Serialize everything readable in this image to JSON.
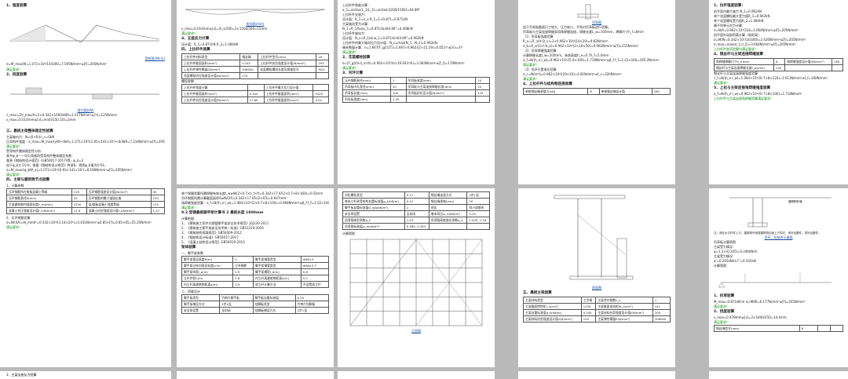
{
  "p1": {
    "s1": "1、强度验算",
    "cap1": "弯矩图(kN·m)",
    "f1": "σ=M_max/W=1.071×10⁶/141000=7.595N/mm²≤[f]=205N/mm²",
    "ok": "满足要求！",
    "s2": "2、挠度验算",
    "cap2": "剪力图(kN)",
    "f2": "τ_max=2V_max/A=2×0.542×1000/489=2.217N/mm²≤[τ]=125N/mm²",
    "f3": "ν_max=0.014mm≤[ν]=min[l/150,10]=2mm",
    "s3": "三、悬挑主梁整体稳定性验算",
    "f4": "主梁轴向力：N=(0+0)/n_s=0kN",
    "f5": "压弯构件强度：σ_max=M_max/(γW)+N/A=1.071×10⁶/(1.05×141×10³)+0/489=7.234N/mm²≤[f]=205N/mm²",
    "ok2": "满足要求！",
    "f6": "受弯构件整体稳定性分析：",
    "f7": "其中φ_b——均匀弯曲的受弯构件整体稳定系数：",
    "f8": "查表《钢结构设计规范》(GB50017-2017)得，φ_b=2",
    "f9": "由于φ_b大于0.6，根据《钢结构设计规范》附录B，得到φ_b值为0.93。",
    "f10": "σ=M_max/(φ_bW_x)=1.071×10⁶/(0.93×141×10³)=8.168N/mm²≤[f]=205N/mm²",
    "ok3": "满足要求！",
    "s4": "四、主梁与建筑物节点验算",
    "s4a": "1、计算参数",
    "t1": [
      [
        "压环钢筋所在楼板混凝土等级",
        "C25",
        "压环钢筋强度设计值(N/mm²)",
        "50"
      ],
      [
        "压环钢筋直径d(mm)",
        "20",
        "压环钢筋的最小锚固长度",
        "150"
      ],
      [
        "主梁建筑物内锚固长度L_m(mm)",
        "1200",
        "梁/楼板混凝土强度等级",
        "C25"
      ],
      [
        "混凝土抗压强度设计值f_c(N/mm²)",
        "11.9",
        "混凝土抗拉强度设计值f_t(N/mm²)",
        "1.27"
      ]
    ],
    "f11": "2、压环钢筋验算",
    "f12": "σ=N/(4A)=N_m/πd²=0.542×10³/(3.14×20²)=0.431N/mm²≤0.85×[f]=0.85×65=55.25N/mm²",
    "ok4": "满足要求！",
    "s5": "3、主梁支座反力验算"
  },
  "p2": {
    "cap1": "变形图(mm)",
    "f1": "ν_max=0.014mm≤[ν]=2l_x/200=2×1500/200=15mm",
    "ok": "满足要求！",
    "s1": "4、支座反力计算",
    "f2": "设计值：R_1=0.871kN  R_2=1.084kN",
    "s2": "四、上拉杆件验算",
    "t1": [
      [
        "上拉杆件材料类型",
        "钢丝绳",
        "上拉杆件型号(mm)",
        "20"
      ],
      [
        "上拉杆件截面面积(mm²)",
        "0.342",
        "上拉杆件抗拉强度设计值(N/mm²)",
        "205"
      ],
      [
        "上拉杆件弹性模量(N/mm²)",
        "206000",
        "花篮螺栓螺纹长度及规格型号",
        "M22"
      ],
      [
        "花篮螺栓抗拉强度设计值(N/mm²)",
        "170",
        "",
        ""
      ]
    ],
    "note": "螺栓参数：",
    "t2": [
      [
        "上拉杆件角度计算",
        "",
        "上拉杆件最大拉力设计值",
        ""
      ],
      [
        "上拉杆件截面面积(mm²)",
        "0.342",
        "上拉杆件截面面积(mm²)",
        "5420"
      ],
      [
        "上拉杆件抗拉强度设计值(N/mm²)",
        "17.65",
        "上拉杆件截面面积(mm²)",
        "4.52"
      ]
    ],
    "f3": "单个焊缝验算所需焊缝有效长度l_w≥N/(2×0.7×h_f×f)=0.342×17.6/(2×0.7×8×160)=0.03mm",
    "f4": "吊环钢筋所需计算截面面积A≥N/(2f)=0.342×17.65/(2×65)=0.047mm²",
    "f5": "角焊缝强度验算：σ_f=N/(h_e·l_w)=1.084×10³/(2×0.7×8×100)=0.968N/mm²≤β_f·f_f=1.22×160=195.2N/mm²",
    "ok2": "满足要求！",
    "s3": "9.2 型钢悬挑脚手架计算书 2 悬挑长度 1800mm",
    "s4": "计算依据：",
    "refs": [
      "1、《建筑施工扣件式钢管脚手架安全技术规范》JGJ130-2011",
      "2、《建筑施工脚手架安全技术统一标准》GB51210-2016",
      "3、《建筑结构荷载规范》GB50009-2012",
      "4、《钢结构设计标准》GB50017-2017",
      "5、《混凝土结构设计规范》GB50010-2010"
    ],
    "s5": "架体验算",
    "s6": "一、脚手架参数",
    "t3": [
      [
        "脚手架搭设高度H(m)",
        "1",
        "脚手架钢管类型",
        "Φ48×3"
      ],
      [
        "脚手架沿纵向搭设长度L(m)",
        "立杆横距",
        "脚手架钢管类型",
        "Φ48×2.7"
      ],
      [
        "脚手架纵距l_a(m)",
        "1.5",
        "脚手架横距l_b(m)",
        "0.8"
      ],
      [
        "立杆步距h(m)",
        "1.8",
        "内立杆离建筑物距离a(m)",
        "0.2"
      ],
      [
        "内立杆离建筑物距离a(m)",
        "0.9",
        "双立杆计算方法",
        "不设置双立杆"
      ]
    ],
    "s7": "二、荷载设计",
    "t4": [
      [
        "脚手板类型",
        "竹串片脚手板",
        "脚手板自重标准值",
        "0.35"
      ],
      [
        "脚手板铺设方式",
        "2步1设",
        "挡脚板类型",
        "竹串片挡脚板"
      ],
      [
        "安全网设置",
        "全封闭",
        "挡脚板铺设方式",
        "2步1设"
      ]
    ]
  },
  "p3": {
    "f1": "上拉杆件角度计算：",
    "f2": "α_1=arctan(L_1/L_2)=arctan(3200/1500)=64.89°",
    "f3": "上拉杆件支座力：",
    "f4": "设计值：R_1=n_x·R_1=1×0.871=0.871kN",
    "f5": "主梁轴向受力计算：",
    "f6": "N_1=R_1/tanα_1=0.871/tan64.89°=0.408kN",
    "f7": "上拉杆件轴向力：",
    "f8": "设计值：N_z=R_1/sinα_1=0.871/sin64.89°=0.962kN",
    "f9": "上拉杆件的最大轴向拉力设计值：N_s=max[N_1...N_z]=0.962kN",
    "f10": "绳夹数量计算：n=1.667[F_g]/(2T)=1.667×0.962/(2×15.19)=0.053个≤[n]=3个",
    "ok": "满足要求！",
    "s1": "2、花篮螺栓验算",
    "f11": "σ=[F_g]/(π·d_e²/4)=0.962×10³/(π×19.933²/4)=3.083N/mm²≤[f_t]=170N/mm²",
    "ok2": "满足要求！",
    "s2": "3、吊环计算",
    "t1": [
      [
        "压环钢筋直径(mm)",
        "1",
        "吊耳板厚度(mm)",
        "10"
      ],
      [
        "吊耳板内孔直径(mm)",
        "20",
        "吊耳板与主梁连接焊缝长度(mm)",
        "10"
      ],
      [
        "吊耳板长度(mm)",
        "100",
        "吊耳板抗拉设计值(N/mm²)",
        "215"
      ],
      [
        "吊耳板宽度(mm)",
        "1.25",
        "",
        ""
      ]
    ],
    "t2": [
      [
        "对拉螺栓类型",
        "0.17",
        "钢丝绳连接方式",
        "2步1设"
      ],
      [
        "每米立杆承受结构自重标准值g_k(kN/m)",
        "0.12",
        "钢丝绳规格(mm)",
        "20"
      ],
      [
        "脚手板自重标准值G_kjb(kN/m²)",
        "2",
        "地区",
        "四川成都市"
      ],
      [
        "安全网设置",
        "全封闭",
        "基本风压ω_0(kN/m²)",
        "0.25"
      ],
      [
        "风荷载体型系数μ_s",
        "1.04",
        "风荷载高度变化系数μ_z",
        "1.433, 1.34"
      ],
      [
        "风荷载标准值ω_k(kN/m²)",
        "0.369, 0.344",
        "",
        ""
      ]
    ],
    "cap": "计算简图",
    "cap2": "立面图"
  },
  "p4": {
    "cap1": "吊耳图",
    "f1": "由于吊耳板截面尺寸较大，压力较小，不再对吊耳板进行验算。",
    "f2": "吊耳板与主梁连接焊缝采用角焊缝连接，焊缝长度L_w=100mm，焊脚尺寸h_f=8mm",
    "s1": "（1）吊耳板强度验算",
    "f3": "R_z=2F_z/(t·D_c)=2×0.962×10³/(10×20)=9.62N/mm²",
    "f4": "σ_b=R_z/(2×t·b_e)=0.962×10³/(2×10×50)=0.962N/mm²≤[f]=215N/mm²",
    "s2": "（2）吊耳焊缝强度验算",
    "f5": "计算焊缝长度l_w=100mm，有效高度h_e=0.7h_f=5.6mm",
    "f6": "σ_f=N/(h_e·l_w)=0.962×10³/(5.6×100)=1.718N/mm²≤β_f·f_f=1.22×160=195.2N/mm²",
    "ok": "满足要求！",
    "s3": "（3）吊环孔壁承压验算",
    "f7": "σ_c=N/(d·t)=0.962×10³/(20×10)=4.81N/mm²≤f_c=320N/mm²",
    "ok2": "满足要求！",
    "s4": "4、上拉杆件与结构物连接验算",
    "t1": [
      [
        "单根钢丝绳承载力(kN)",
        "8",
        "单根钢丝绳设计值",
        "160"
      ]
    ],
    "cap2": "剖面图",
    "s5": "五、悬挑主梁验算",
    "t2": [
      [
        "主梁材料类型",
        "工字钢",
        "主梁合并根数n_s",
        "1"
      ],
      [
        "主梁截面惯性矩I_x(cm⁴)",
        "1130",
        "主梁截面抵抗矩W_x(cm³)",
        "141"
      ],
      [
        "主梁自重标准值g_k(kN/m)",
        "0.205",
        "主梁材料抗弯强度设计值f(N/mm²)",
        "205"
      ],
      [
        "主梁材料抗剪强度设计值τ(N/mm²)",
        "125",
        "主梁弹性模量E(N/mm²)",
        "206000"
      ]
    ]
  },
  "p5": {
    "s1": "1、拉杆强度验算：",
    "f1": "由平面内最大轴力 N_1=0.962kN",
    "f2": "单个花篮螺栓最大受力值R_1=0.962kN",
    "f3": "单个花篮螺栓受力值R_2=1.084kN",
    "f4": "最不利单元内力计算：",
    "f5": "σ=N/A=0.962×10³/314=3.064N/mm²≤[f]=205N/mm²",
    "f6": "由平面外局部荷载计算（取距离）",
    "f7": "σ=M/W=0.342×10⁶/141000=2.426N/mm²≤[f]=205N/mm²",
    "f8": "σ_max=max(σ_1,σ_2)=3.064N/mm²≤[f]=205N/mm²",
    "ok": "上拉杆件各项验算均满足要求！",
    "s2": "4、钢丝杆与主梁连接焊缝验算",
    "t1": [
      [
        "角焊缝焊脚尺寸h_f(mm)",
        "8",
        "角焊缝强度设计值f(N/mm²)",
        "160"
      ],
      [
        "钢丝杆与主梁连接焊缝长度l_w(mm)",
        "120",
        "",
        ""
      ]
    ],
    "f9": "钢丝杆与主梁连接焊缝强度验算：",
    "f10": "τ_f=N/(h_e·l_w)=1.084×10³/(0.7×8×120)=1.613N/mm²≤f_f=160N/mm²",
    "ok2": "满足要求！",
    "s3": "5、上拉与主梁连接角焊缝强度验算",
    "f11": "σ_f=N/(h_e·l_w)=0.962×10³/(0.7×8×100)=1.718N/mm²",
    "ok3": "上拉杆件与主梁连接角焊缝验算满足要求！",
    "lbl1": "建筑物外墙",
    "lbl2": "注：请在水平杆件上方，建筑物外侧或建筑物边缘上方件时，请补加要件；须补加要件；",
    "cap": "吊环、拉结件示意图",
    "f12": "吊耳板计算简图",
    "f13": "主梁受力情况：",
    "f14": "q=1.2×(0.205)=0.246kN/m",
    "f15": "主梁受力情况：",
    "f16": "q'=0.205kN/m  F'=0.542kN",
    "cap2": "计算简图：",
    "s4": "1、抗弯验算",
    "f17": "M_max=0.871kN·m  σ=M/W=6.177N/mm²≤[f]=205N/mm²",
    "ok4": "满足要求！",
    "s5": "2、挠度验算",
    "f18": "ν_max=0.478mm≤[ν]=2×1800/250=14.4mm",
    "ok5": "满足要求！",
    "t2": [
      [
        "钢丝绳型号(mm)",
        "8",
        "",
        ""
      ]
    ]
  }
}
